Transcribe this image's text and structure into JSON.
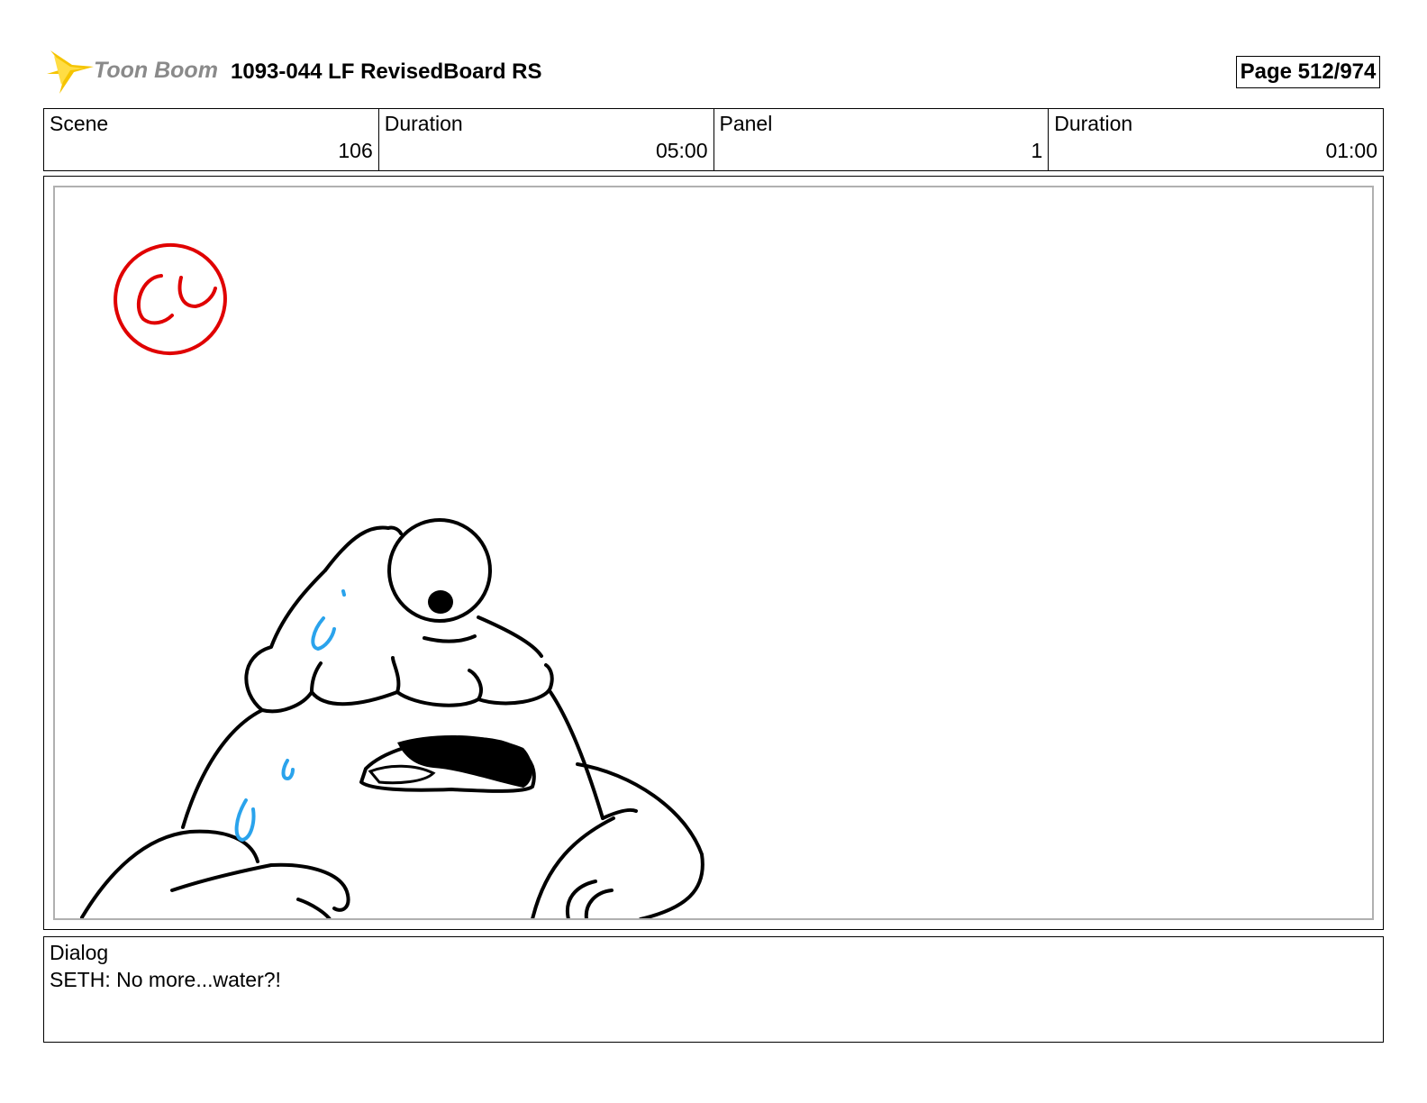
{
  "header": {
    "logo_text": "Toon Boom",
    "title": "1093-044 LF RevisedBoard RS",
    "page_label": "Page 512/974"
  },
  "info": {
    "scene_label": "Scene",
    "scene_value": "106",
    "scene_duration_label": "Duration",
    "scene_duration_value": "05:00",
    "panel_label": "Panel",
    "panel_value": "1",
    "panel_duration_label": "Duration",
    "panel_duration_value": "01:00"
  },
  "dialog": {
    "label": "Dialog",
    "text": "SETH: No more...water?!"
  },
  "colors": {
    "stamp": "#e00000",
    "sweat": "#2aa3ec",
    "logo_star": "#f5c400"
  },
  "icons": [
    "toon-boom-logo-icon",
    "cc-stamp-icon",
    "character-sketch"
  ]
}
